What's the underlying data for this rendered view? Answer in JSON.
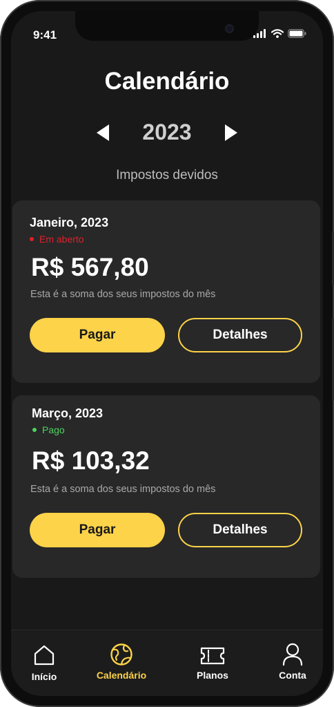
{
  "status_bar": {
    "time": "9:41"
  },
  "header": {
    "title": "Calendário"
  },
  "year_selector": {
    "year": "2023"
  },
  "section": {
    "label": "Impostos devidos"
  },
  "cards": [
    {
      "month": "Janeiro, 2023",
      "status": "Em aberto",
      "status_color": "#e0202a",
      "amount": "R$ 567,80",
      "description": "Esta é a soma dos seus impostos do mês",
      "pay_label": "Pagar",
      "details_label": "Detalhes"
    },
    {
      "month": "Março, 2023",
      "status": "Pago",
      "status_color": "#4cd35f",
      "amount": "R$ 103,32",
      "description": "Esta é a soma dos seus impostos do mês",
      "pay_label": "Pagar",
      "details_label": "Detalhes"
    }
  ],
  "tabbar": {
    "items": [
      {
        "label": "Início",
        "icon": "home-icon",
        "active": false
      },
      {
        "label": "Calendário",
        "icon": "globe-icon",
        "active": true
      },
      {
        "label": "Planos",
        "icon": "ticket-icon",
        "active": false
      },
      {
        "label": "Conta",
        "icon": "user-icon",
        "active": false
      }
    ]
  },
  "colors": {
    "accent": "#fdd349",
    "background": "#191919",
    "card": "#282828"
  }
}
